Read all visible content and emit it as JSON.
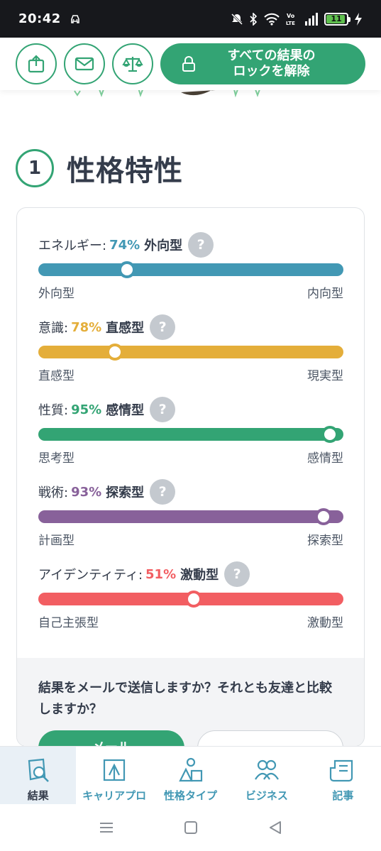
{
  "status_bar": {
    "time": "20:42",
    "battery": "11"
  },
  "toolbar": {
    "unlock_line1": "すべての結果の",
    "unlock_line2": "ロックを解除"
  },
  "section": {
    "number": "1",
    "title": "性格特性"
  },
  "traits": [
    {
      "name": "エネルギー:",
      "percent": "74%",
      "type": "外向型",
      "left": "外向型",
      "right": "内向型",
      "color": "#4298b4",
      "position": 0.29
    },
    {
      "name": "意識:",
      "percent": "78%",
      "type": "直感型",
      "left": "直感型",
      "right": "現実型",
      "color": "#e4ae3a",
      "position": 0.25
    },
    {
      "name": "性質:",
      "percent": "95%",
      "type": "感情型",
      "left": "思考型",
      "right": "感情型",
      "color": "#33a474",
      "position": 0.955
    },
    {
      "name": "戦術:",
      "percent": "93%",
      "type": "探索型",
      "left": "計画型",
      "right": "探索型",
      "color": "#88619a",
      "position": 0.935
    },
    {
      "name": "アイデンティティ:",
      "percent": "51%",
      "type": "激動型",
      "left": "自己主張型",
      "right": "激動型",
      "color": "#f25e62",
      "position": 0.51
    }
  ],
  "help_symbol": "?",
  "share": {
    "text": "結果をメールで送信しますか？それとも友達と比較しますか？",
    "mail_button": "メール"
  },
  "bottom_nav": [
    {
      "label": "結果",
      "icon": "results-icon",
      "active": true
    },
    {
      "label": "キャリアプロ",
      "icon": "career-icon",
      "active": false
    },
    {
      "label": "性格タイプ",
      "icon": "personality-types-icon",
      "active": false
    },
    {
      "label": "ビジネス",
      "icon": "business-icon",
      "active": false
    },
    {
      "label": "記事",
      "icon": "articles-icon",
      "active": false
    }
  ],
  "colors": {
    "accent": "#33a474",
    "nav_text": "#4298b4"
  }
}
